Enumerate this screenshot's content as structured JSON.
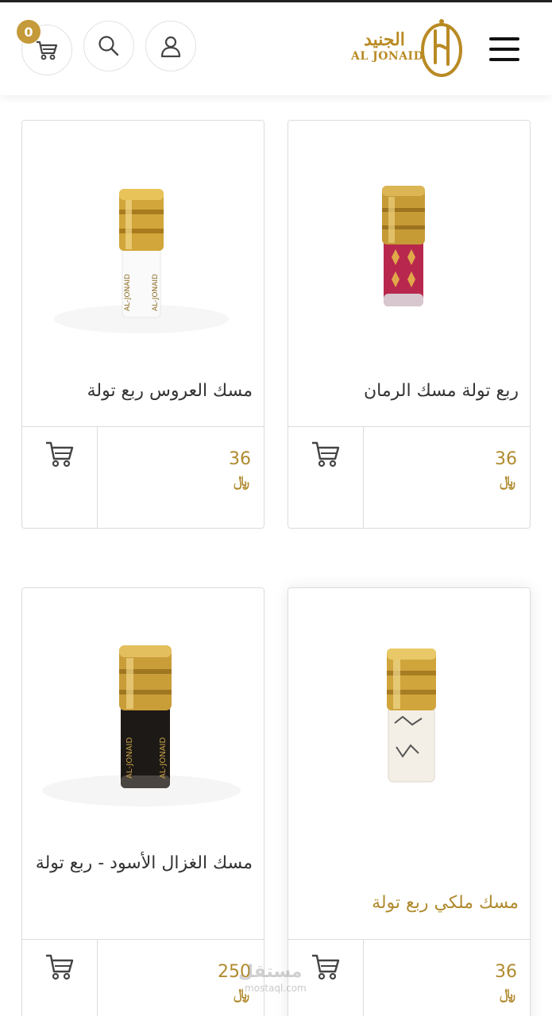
{
  "header": {
    "cart_count": "0",
    "logo_arabic": "الجنيد",
    "logo_english": "AL JONAID"
  },
  "icons": {
    "cart": "cart-icon",
    "search": "search-icon",
    "user": "user-icon",
    "menu": "hamburger-menu-icon"
  },
  "colors": {
    "accent_gold": "#b08a2e",
    "badge": "#c49a3a"
  },
  "products": [
    {
      "name": "مسك العروس ربع تولة",
      "price": "36",
      "currency": "﷼"
    },
    {
      "name": "ربع تولة مسك الرمان",
      "price": "36",
      "currency": "﷼"
    },
    {
      "name": "مسك الغزال الأسود - ربع تولة",
      "price": "250",
      "currency": "﷼"
    },
    {
      "name": "مسك ملكي ربع تولة",
      "price": "36",
      "currency": "﷼"
    }
  ],
  "watermark": {
    "text": "مستقل",
    "sub": "mostaql.com"
  }
}
